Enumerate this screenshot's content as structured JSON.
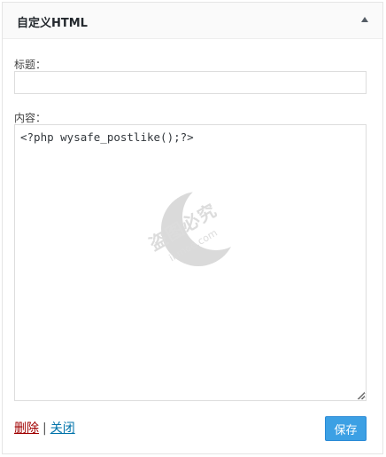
{
  "widget": {
    "title": "自定义HTML",
    "toggle_icon": "triangle-up-icon"
  },
  "form": {
    "title_label": "标题：",
    "title_value": "",
    "content_label": "内容：",
    "content_value": "<?php wysafe_postlike();?>"
  },
  "watermark": {
    "text": "盗图必究",
    "sub": "ikmoe.com"
  },
  "actions": {
    "delete_label": "删除",
    "separator": "|",
    "close_label": "关闭",
    "save_label": "保存"
  },
  "colors": {
    "save_bg": "#3ca0e4",
    "delete_link": "#a00000",
    "close_link": "#0073aa"
  }
}
